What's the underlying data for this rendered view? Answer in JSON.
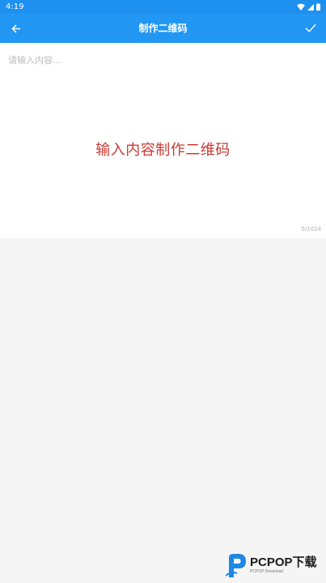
{
  "status_bar": {
    "time": "4:19",
    "icons": [
      "wifi-icon",
      "signal-icon",
      "battery-icon"
    ]
  },
  "app_bar": {
    "title": "制作二维码",
    "back_icon": "arrow-left-icon",
    "confirm_icon": "check-icon"
  },
  "content_input": {
    "placeholder": "请输入内容...",
    "value": "",
    "counter": "0/1024"
  },
  "overlay_caption": "输入内容制作二维码",
  "watermark": {
    "title": "PCPOP下载",
    "subtitle": "PCPOP Download"
  },
  "colors": {
    "status_bar": "#1e90f0",
    "app_bar": "#2196f3",
    "caption": "#c93a34",
    "page_background": "#f5f5f5",
    "card_background": "#ffffff",
    "watermark_blue": "#1e88e5"
  }
}
